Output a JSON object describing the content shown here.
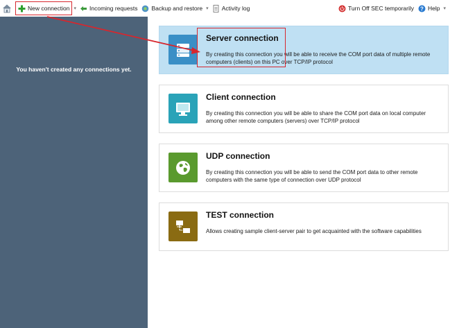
{
  "toolbar": {
    "new_connection": "New connection",
    "incoming_requests": "Incoming requests",
    "backup_restore": "Backup and restore",
    "activity_log": "Activity log",
    "turn_off_sec": "Turn Off SEC temporarily",
    "help": "Help",
    "dropdown_glyph": "▾"
  },
  "sidebar": {
    "empty_message": "You haven't created any connections yet."
  },
  "connections": [
    {
      "title": "Server connection",
      "description": "By creating this connection you will be able to receive the COM port data of multiple remote computers (clients) on this PC over TCP/IP protocol",
      "icon": "server-icon",
      "color": "#3a8fc6",
      "selected": true
    },
    {
      "title": "Client connection",
      "description": "By creating this connection you will be able to share the COM port data on local computer among other remote computers (servers) over TCP/IP protocol",
      "icon": "monitor-icon",
      "color": "#2aa3b8",
      "selected": false
    },
    {
      "title": "UDP connection",
      "description": "By creating this connection you will be able to send the COM port data to other remote computers with the same type of connection over UDP protocol",
      "icon": "globe-icon",
      "color": "#5a9a2e",
      "selected": false
    },
    {
      "title": "TEST connection",
      "description": "Allows creating sample client-server pair to get acquainted with the software capabilities",
      "icon": "test-network-icon",
      "color": "#8a6b12",
      "selected": false
    }
  ],
  "colors": {
    "sidebar_bg": "#4d6379",
    "selected_card_bg": "#bfe0f3",
    "annotation_red": "#d7262d"
  }
}
